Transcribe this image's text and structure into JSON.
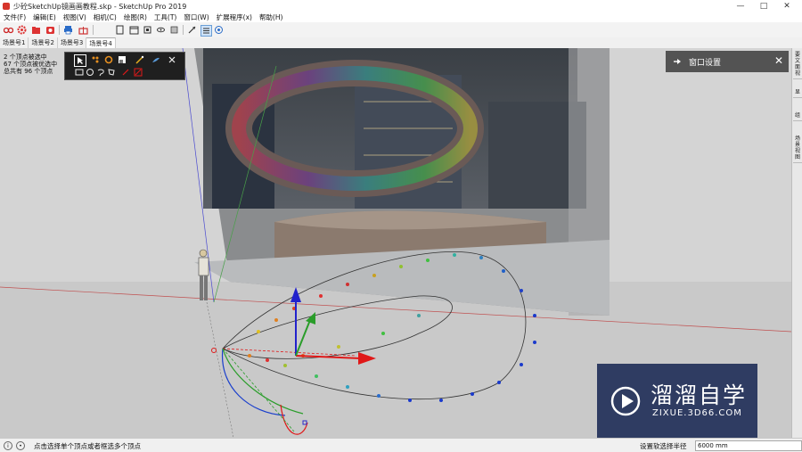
{
  "window": {
    "title": "少砼SketchUp镜画画教程.skp - SketchUp Pro 2019",
    "controls": [
      "—",
      "□",
      "✕"
    ]
  },
  "menu": [
    "文件(F)",
    "编辑(E)",
    "视图(V)",
    "相机(C)",
    "绘图(R)",
    "工具(T)",
    "窗口(W)",
    "扩展程序(x)",
    "帮助(H)"
  ],
  "scene_tabs": [
    "场景号1",
    "场景号2",
    "场景号3",
    "场景号4"
  ],
  "active_scene_index": 3,
  "selection_info": [
    "2 个顶点被选中",
    "67 个顶点被优选中",
    "总共有 96 个顶点"
  ],
  "window_settings": {
    "label": "窗口设置",
    "close": "✕"
  },
  "right_tray_tabs": [
    "要文面视",
    "显",
    "组",
    "场景视图"
  ],
  "status": {
    "message": "点击选择单个顶点或者框选多个顶点",
    "vcb_label": "设置软选择半径",
    "vcb_value": "6000 mm"
  },
  "watermark": {
    "name": "溜溜自学",
    "url": "ZIXUE.3D66.COM"
  },
  "colors": {
    "axis_red": "#e01818",
    "axis_green": "#2a9d2a",
    "axis_blue": "#2222cc",
    "brand_red": "#d6352b"
  }
}
